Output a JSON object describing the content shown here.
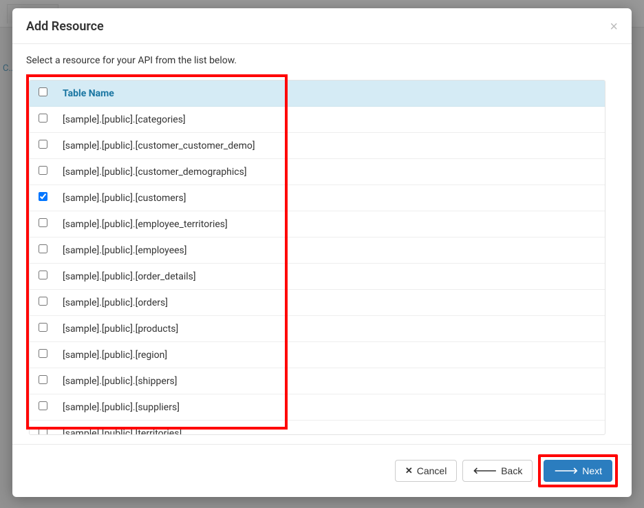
{
  "background": {
    "tab": "C..."
  },
  "modal": {
    "title": "Add Resource",
    "instruction": "Select a resource for your API from the list below.",
    "table": {
      "header_checkbox_checked": false,
      "header_name": "Table Name",
      "rows": [
        {
          "checked": false,
          "label": "[sample].[public].[categories]"
        },
        {
          "checked": false,
          "label": "[sample].[public].[customer_customer_demo]"
        },
        {
          "checked": false,
          "label": "[sample].[public].[customer_demographics]"
        },
        {
          "checked": true,
          "label": "[sample].[public].[customers]"
        },
        {
          "checked": false,
          "label": "[sample].[public].[employee_territories]"
        },
        {
          "checked": false,
          "label": "[sample].[public].[employees]"
        },
        {
          "checked": false,
          "label": "[sample].[public].[order_details]"
        },
        {
          "checked": false,
          "label": "[sample].[public].[orders]"
        },
        {
          "checked": false,
          "label": "[sample].[public].[products]"
        },
        {
          "checked": false,
          "label": "[sample].[public].[region]"
        },
        {
          "checked": false,
          "label": "[sample].[public].[shippers]"
        },
        {
          "checked": false,
          "label": "[sample].[public].[suppliers]"
        },
        {
          "checked": false,
          "label": "[sample].[public].[territories]"
        }
      ]
    },
    "footer": {
      "cancel": "Cancel",
      "back": "Back",
      "next": "Next"
    }
  }
}
